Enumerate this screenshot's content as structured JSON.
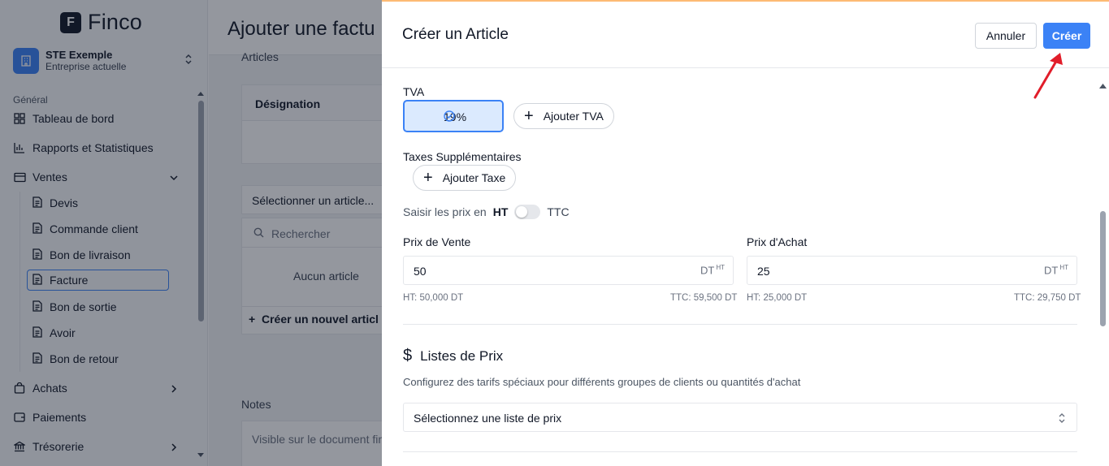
{
  "brand": {
    "logo_letter": "F",
    "name": "Finco"
  },
  "company": {
    "name": "STE Exemple",
    "subtitle": "Entreprise actuelle"
  },
  "sidebar": {
    "section_label": "Général",
    "items": [
      {
        "label": "Tableau de bord"
      },
      {
        "label": "Rapports et Statistiques"
      },
      {
        "label": "Ventes"
      },
      {
        "label": "Achats"
      },
      {
        "label": "Paiements"
      },
      {
        "label": "Trésorerie"
      }
    ],
    "ventes_sub": [
      {
        "label": "Devis"
      },
      {
        "label": "Commande client"
      },
      {
        "label": "Bon de livraison"
      },
      {
        "label": "Facture"
      },
      {
        "label": "Bon de sortie"
      },
      {
        "label": "Avoir"
      },
      {
        "label": "Bon de retour"
      }
    ]
  },
  "page": {
    "title": "Ajouter une factu",
    "articles_label": "Articles",
    "designation_header": "Désignation",
    "select_article": "Sélectionner un article...",
    "search_placeholder": "Rechercher",
    "empty_text": "Aucun article",
    "create_new": "Créer un nouvel articl",
    "notes_label": "Notes",
    "notes_placeholder": "Visible sur le document fin"
  },
  "sheet": {
    "title": "Créer un Article",
    "cancel_label": "Annuler",
    "create_label": "Créer",
    "tva_label": "TVA",
    "tva_selected": "19%",
    "add_tva": "Ajouter TVA",
    "extra_taxes_label": "Taxes Supplémentaires",
    "add_tax": "Ajouter Taxe",
    "price_mode_prefix": "Saisir les prix en",
    "price_mode_ht": "HT",
    "price_mode_ttc": "TTC",
    "sale_price_label": "Prix de Vente",
    "sale_price_value": "50",
    "sale_ht": "HT: 50,000 DT",
    "sale_ttc": "TTC: 59,500 DT",
    "purchase_price_label": "Prix d'Achat",
    "purchase_price_value": "25",
    "purchase_ht": "HT: 25,000 DT",
    "purchase_ttc": "TTC: 29,750 DT",
    "currency_unit": "DT",
    "currency_sup": "HT",
    "price_lists_title": "Listes de Prix",
    "price_lists_desc": "Configurez des tarifs spéciaux pour différents groupes de clients ou quantités d'achat",
    "price_list_select": "Sélectionnez une liste de prix"
  },
  "colors": {
    "accent": "#3b82f6",
    "annotation_arrow": "#e11d2a"
  }
}
